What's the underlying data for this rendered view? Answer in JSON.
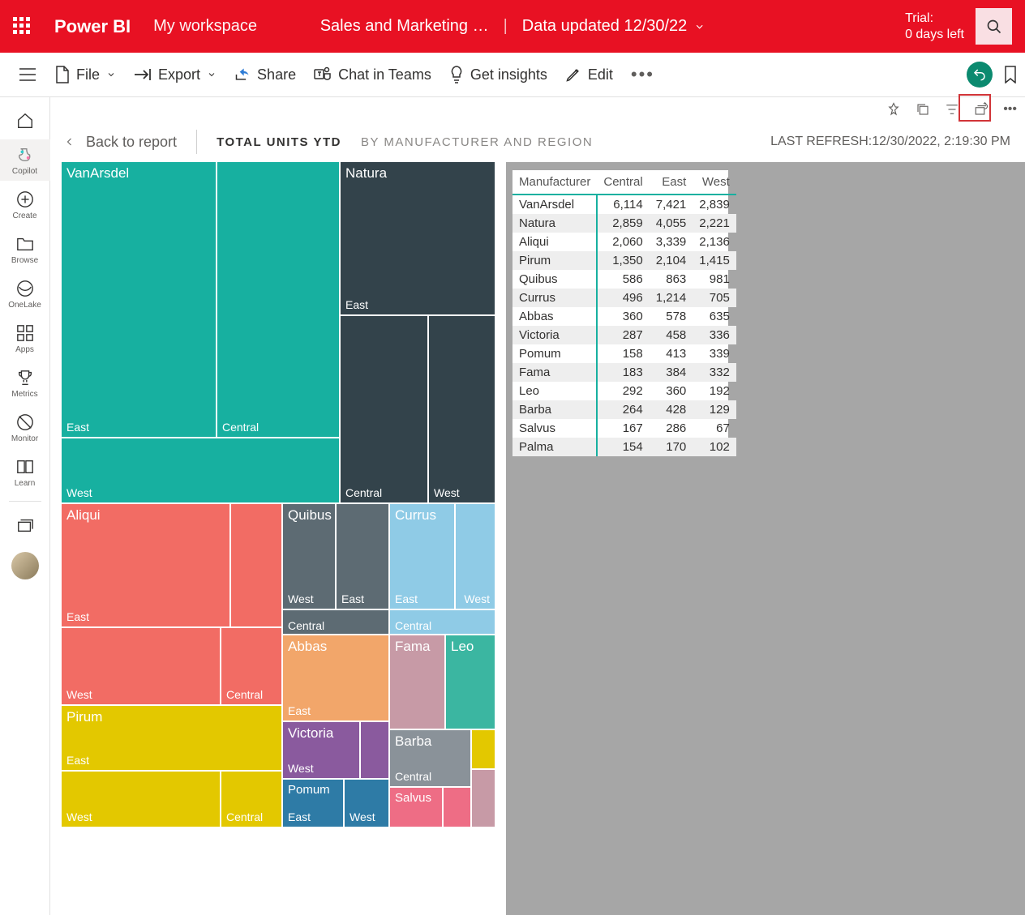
{
  "topbar": {
    "brand": "Power BI",
    "workspace": "My workspace",
    "report_title": "Sales and Marketing …",
    "updated_label": "Data updated 12/30/22",
    "trial_line1": "Trial:",
    "trial_line2": "0 days left"
  },
  "toolbar": {
    "file": "File",
    "export": "Export",
    "share": "Share",
    "chat": "Chat in Teams",
    "insights": "Get insights",
    "edit": "Edit"
  },
  "leftnav": {
    "home": "",
    "copilot": "Copilot",
    "create": "Create",
    "browse": "Browse",
    "onelake": "OneLake",
    "apps": "Apps",
    "metrics": "Metrics",
    "monitor": "Monitor",
    "learn": "Learn"
  },
  "breadcrumb": {
    "back": "Back to report",
    "title": "TOTAL UNITS YTD",
    "subtitle": "BY MANUFACTURER AND REGION",
    "refresh_prefix": "LAST REFRESH:",
    "refresh_value": "12/30/2022, 2:19:30 PM"
  },
  "treemap_labels": {
    "vanarsdel": "VanArsdel",
    "natura": "Natura",
    "aliqui": "Aliqui",
    "quibus": "Quibus",
    "currus": "Currus",
    "pirum": "Pirum",
    "abbas": "Abbas",
    "fama": "Fama",
    "leo": "Leo",
    "victoria": "Victoria",
    "barba": "Barba",
    "pomum": "Pomum",
    "salvus": "Salvus",
    "east": "East",
    "central": "Central",
    "west": "West"
  },
  "table": {
    "headers": {
      "mfg": "Manufacturer",
      "central": "Central",
      "east": "East",
      "west": "West"
    },
    "rows": [
      {
        "mfg": "VanArsdel",
        "central": "6,114",
        "east": "7,421",
        "west": "2,839"
      },
      {
        "mfg": "Natura",
        "central": "2,859",
        "east": "4,055",
        "west": "2,221"
      },
      {
        "mfg": "Aliqui",
        "central": "2,060",
        "east": "3,339",
        "west": "2,136"
      },
      {
        "mfg": "Pirum",
        "central": "1,350",
        "east": "2,104",
        "west": "1,415"
      },
      {
        "mfg": "Quibus",
        "central": "586",
        "east": "863",
        "west": "981"
      },
      {
        "mfg": "Currus",
        "central": "496",
        "east": "1,214",
        "west": "705"
      },
      {
        "mfg": "Abbas",
        "central": "360",
        "east": "578",
        "west": "635"
      },
      {
        "mfg": "Victoria",
        "central": "287",
        "east": "458",
        "west": "336"
      },
      {
        "mfg": "Pomum",
        "central": "158",
        "east": "413",
        "west": "339"
      },
      {
        "mfg": "Fama",
        "central": "183",
        "east": "384",
        "west": "332"
      },
      {
        "mfg": "Leo",
        "central": "292",
        "east": "360",
        "west": "192"
      },
      {
        "mfg": "Barba",
        "central": "264",
        "east": "428",
        "west": "129"
      },
      {
        "mfg": "Salvus",
        "central": "167",
        "east": "286",
        "west": "67"
      },
      {
        "mfg": "Palma",
        "central": "154",
        "east": "170",
        "west": "102"
      }
    ]
  },
  "chart_data": {
    "type": "treemap",
    "title": "Total Units YTD by Manufacturer and Region",
    "value_field": "Total Units YTD",
    "levels": [
      "Manufacturer",
      "Region"
    ],
    "series": [
      {
        "name": "VanArsdel",
        "color": "#17b0a0",
        "children": [
          {
            "name": "East",
            "value": 7421
          },
          {
            "name": "Central",
            "value": 6114
          },
          {
            "name": "West",
            "value": 2839
          }
        ]
      },
      {
        "name": "Natura",
        "color": "#33434b",
        "children": [
          {
            "name": "East",
            "value": 4055
          },
          {
            "name": "Central",
            "value": 2859
          },
          {
            "name": "West",
            "value": 2221
          }
        ]
      },
      {
        "name": "Aliqui",
        "color": "#f26c64",
        "children": [
          {
            "name": "East",
            "value": 3339
          },
          {
            "name": "West",
            "value": 2136
          },
          {
            "name": "Central",
            "value": 2060
          }
        ]
      },
      {
        "name": "Quibus",
        "color": "#5d6b73",
        "children": [
          {
            "name": "West",
            "value": 981
          },
          {
            "name": "East",
            "value": 863
          },
          {
            "name": "Central",
            "value": 586
          }
        ]
      },
      {
        "name": "Currus",
        "color": "#8fcbe6",
        "children": [
          {
            "name": "East",
            "value": 1214
          },
          {
            "name": "West",
            "value": 705
          },
          {
            "name": "Central",
            "value": 496
          }
        ]
      },
      {
        "name": "Pirum",
        "color": "#e3c800",
        "children": [
          {
            "name": "East",
            "value": 2104
          },
          {
            "name": "West",
            "value": 1415
          },
          {
            "name": "Central",
            "value": 1350
          }
        ]
      },
      {
        "name": "Abbas",
        "color": "#f2a66a",
        "children": [
          {
            "name": "East",
            "value": 578
          },
          {
            "name": "West",
            "value": 635
          },
          {
            "name": "Central",
            "value": 360
          }
        ]
      },
      {
        "name": "Fama",
        "color": "#c79aa6",
        "children": [
          {
            "name": "East",
            "value": 384
          },
          {
            "name": "West",
            "value": 332
          },
          {
            "name": "Central",
            "value": 183
          }
        ]
      },
      {
        "name": "Leo",
        "color": "#3bb6a1",
        "children": [
          {
            "name": "East",
            "value": 360
          },
          {
            "name": "Central",
            "value": 292
          },
          {
            "name": "West",
            "value": 192
          }
        ]
      },
      {
        "name": "Victoria",
        "color": "#8a5a9e",
        "children": [
          {
            "name": "East",
            "value": 458
          },
          {
            "name": "West",
            "value": 336
          },
          {
            "name": "Central",
            "value": 287
          }
        ]
      },
      {
        "name": "Barba",
        "color": "#8a9299",
        "children": [
          {
            "name": "East",
            "value": 428
          },
          {
            "name": "Central",
            "value": 264
          },
          {
            "name": "West",
            "value": 129
          }
        ]
      },
      {
        "name": "Pomum",
        "color": "#2e7ba6",
        "children": [
          {
            "name": "East",
            "value": 413
          },
          {
            "name": "West",
            "value": 339
          },
          {
            "name": "Central",
            "value": 158
          }
        ]
      },
      {
        "name": "Salvus",
        "color": "#ee6d85",
        "children": [
          {
            "name": "East",
            "value": 286
          },
          {
            "name": "Central",
            "value": 167
          },
          {
            "name": "West",
            "value": 67
          }
        ]
      }
    ]
  }
}
